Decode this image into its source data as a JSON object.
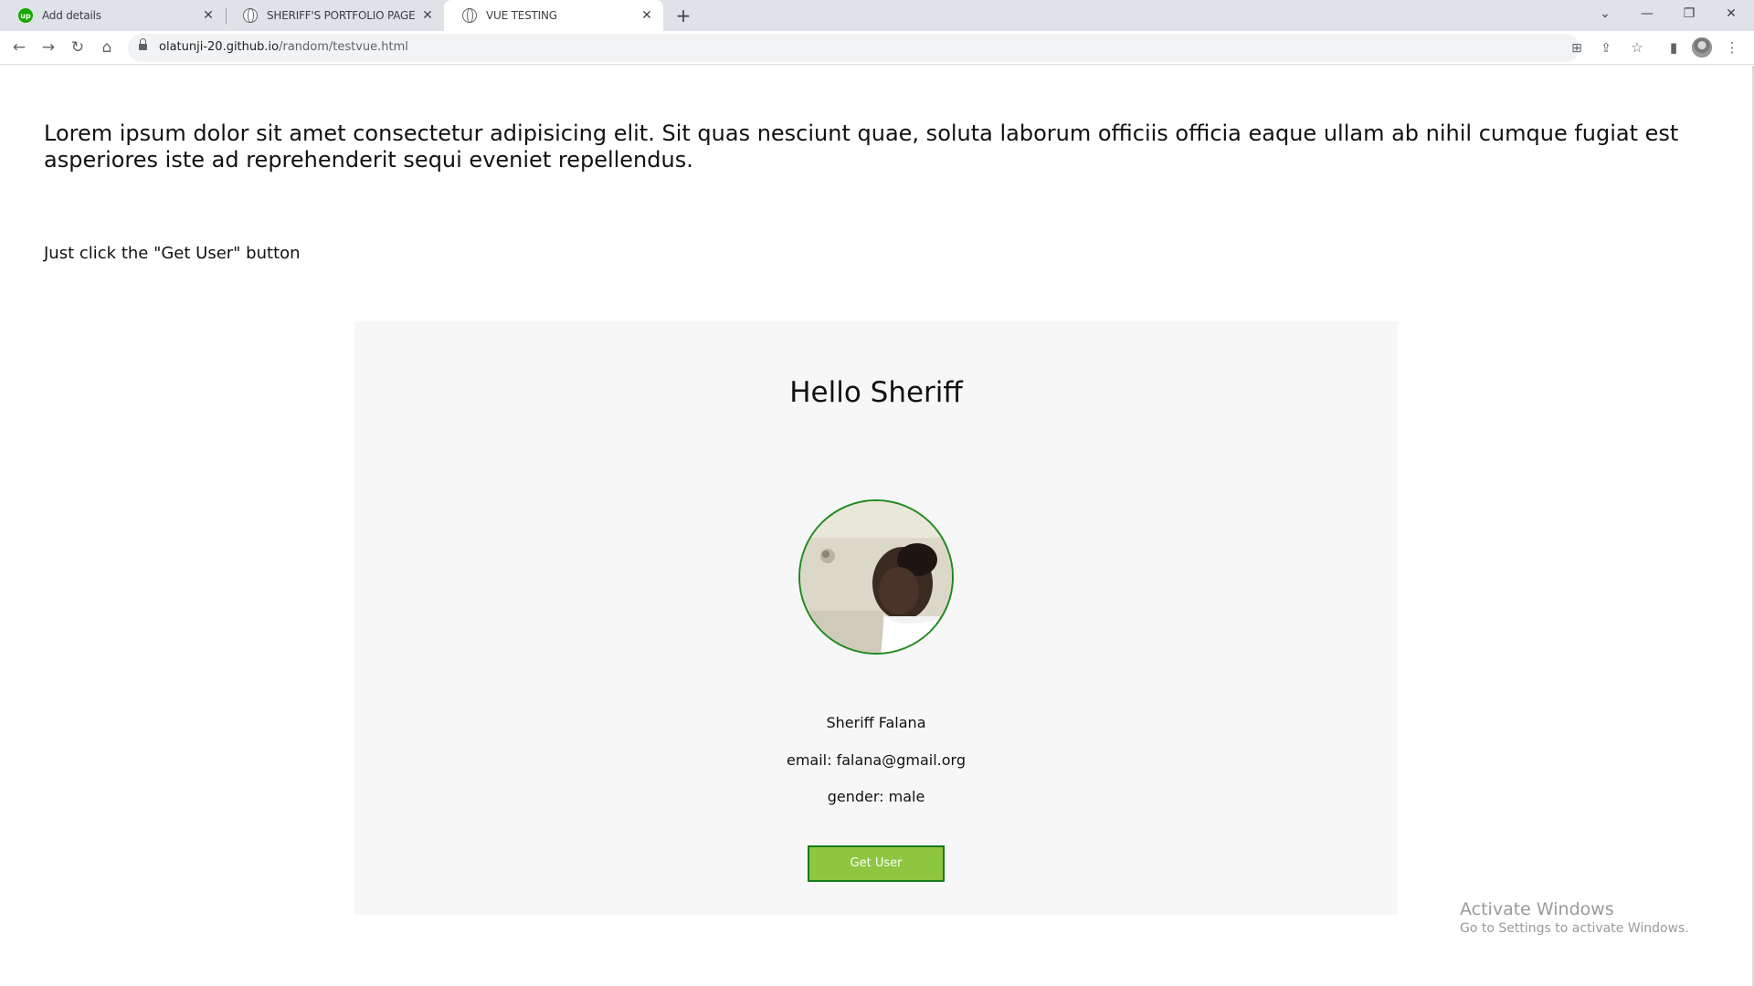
{
  "browser": {
    "tabs": [
      {
        "title": "Add details",
        "favicon": "upwork-icon"
      },
      {
        "title": "SHERIFF'S PORTFOLIO PAGE",
        "favicon": "globe-icon"
      },
      {
        "title": "VUE TESTING",
        "favicon": "globe-icon",
        "active": true
      }
    ],
    "address": {
      "domain": "olatunji-20.github.io",
      "path": "/random/testvue.html"
    }
  },
  "page": {
    "intro": "Lorem ipsum dolor sit amet consectetur adipisicing elit. Sit quas nesciunt quae, soluta laborum officiis officia eaque ullam ab nihil cumque fugiat est asperiores iste ad reprehenderit sequi eveniet repellendus.",
    "instruction": "Just click the \"Get User\" button",
    "card": {
      "greeting": "Hello Sheriff",
      "name": "Sheriff Falana",
      "email": "email: falana@gmail.org",
      "gender": "gender: male",
      "button_label": "Get User"
    }
  },
  "watermark": {
    "title": "Activate Windows",
    "subtitle": "Go to Settings to activate Windows."
  },
  "colors": {
    "button_bg": "#8dc63f",
    "button_border": "#1b7a1b",
    "photo_border": "#1e8a1e",
    "card_bg": "#f7f7f7"
  }
}
